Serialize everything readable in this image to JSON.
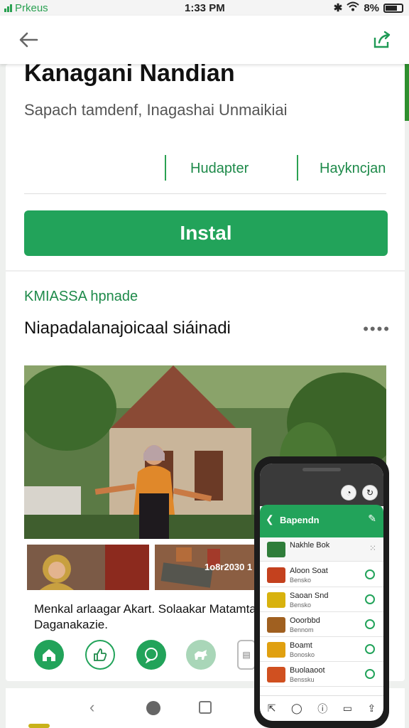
{
  "status_bar": {
    "carrier": "Prkeus",
    "time": "1:33 PM",
    "battery": "8%"
  },
  "app_bar": {
    "back_icon": "arrow-back-icon",
    "share_icon": "share-icon"
  },
  "app": {
    "title": "Kanagani Nandian",
    "subtitle": "Sapach tamdenf, Inagashai Unmaikiai",
    "meta_1": "Hudapter",
    "meta_2": "Haykncjan",
    "install_label": "Instal"
  },
  "section": {
    "label": "KMIASSA hpnade",
    "title": "Niapadalanajoicaal siáinadi",
    "more_label": "••••"
  },
  "media": {
    "thumb_2_text": "1o8r2030 1",
    "description": "Menkal arlaagar Akart. Solaakar Matamtar Daganakazie."
  },
  "actions": [
    {
      "icon": "home-icon"
    },
    {
      "icon": "thumbs-up-icon"
    },
    {
      "icon": "chat-icon"
    },
    {
      "icon": "animal-icon"
    },
    {
      "icon": "more-icon"
    }
  ],
  "phone": {
    "header_title": "Bapendn",
    "rows": [
      {
        "title": "Nakhle Bok",
        "sub": "",
        "color": "#2f7d3a"
      },
      {
        "title": "Aloon Soat",
        "sub": "Bensko",
        "color": "#c4411e"
      },
      {
        "title": "Saoan Snd",
        "sub": "Bensko",
        "color": "#d8b20e"
      },
      {
        "title": "Ooorbbd",
        "sub": "Bennom",
        "color": "#a06020"
      },
      {
        "title": "Boamt",
        "sub": "Bonosko",
        "color": "#e0a010"
      },
      {
        "title": "Buolaaoot",
        "sub": "Benssku",
        "color": "#d05020"
      }
    ]
  },
  "colors": {
    "accent": "#22a35a",
    "accent_text": "#1e8a4a"
  }
}
